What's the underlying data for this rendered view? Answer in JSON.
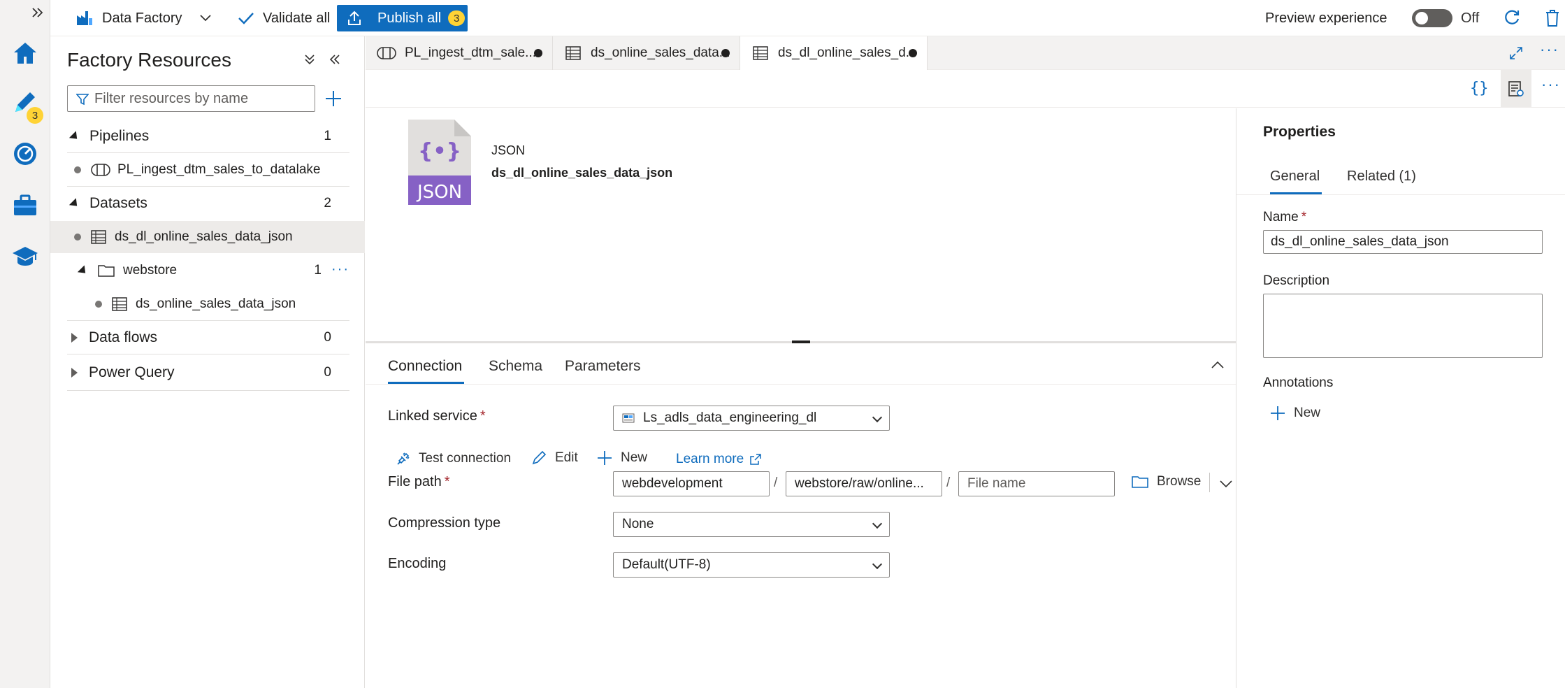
{
  "topbar": {
    "factory_name": "Data Factory",
    "validate_label": "Validate all",
    "publish_label": "Publish all",
    "publish_count": "3",
    "preview_label": "Preview experience",
    "toggle_state": "Off"
  },
  "rail": {
    "author_badge": "3",
    "icons": [
      "home-icon",
      "pencil-icon",
      "monitor-icon",
      "toolbox-icon",
      "learn-icon"
    ]
  },
  "resources": {
    "title": "Factory Resources",
    "filter_placeholder": "Filter resources by name",
    "pipelines": {
      "label": "Pipelines",
      "count": "1",
      "items": [
        "PL_ingest_dtm_sales_to_datalake"
      ]
    },
    "datasets": {
      "label": "Datasets",
      "count": "2",
      "items": [
        "ds_dl_online_sales_data_json"
      ]
    },
    "folder": {
      "label": "webstore",
      "count": "1",
      "items": [
        "ds_online_sales_data_json"
      ]
    },
    "dataflows": {
      "label": "Data flows",
      "count": "0"
    },
    "powerquery": {
      "label": "Power Query",
      "count": "0"
    }
  },
  "tabs": [
    {
      "label": "PL_ingest_dtm_sale..."
    },
    {
      "label": "ds_online_sales_data..."
    },
    {
      "label": "ds_dl_online_sales_d..."
    }
  ],
  "canvas": {
    "type_label": "JSON",
    "icon_text": "JSON",
    "dataset_name": "ds_dl_online_sales_data_json"
  },
  "config": {
    "tabs": [
      "Connection",
      "Schema",
      "Parameters"
    ],
    "linked_service_label": "Linked service",
    "linked_service_value": "Ls_adls_data_engineering_dl",
    "test_connection": "Test connection",
    "edit": "Edit",
    "new": "New",
    "learn_more": "Learn more",
    "file_path_label": "File path",
    "file_path_container": "webdevelopment",
    "file_path_directory": "webstore/raw/online...",
    "file_path_file_placeholder": "File name",
    "browse": "Browse",
    "path_sep": "/",
    "compression_label": "Compression type",
    "compression_value": "None",
    "encoding_label": "Encoding",
    "encoding_value": "Default(UTF-8)"
  },
  "properties": {
    "title": "Properties",
    "tab_general": "General",
    "tab_related": "Related (1)",
    "name_label": "Name",
    "name_value": "ds_dl_online_sales_data_json",
    "description_label": "Description",
    "annotations_label": "Annotations",
    "new_label": "New"
  },
  "colors": {
    "accent": "#0f6cbd",
    "badge": "#ffd335",
    "json_icon": "#8661c5"
  }
}
